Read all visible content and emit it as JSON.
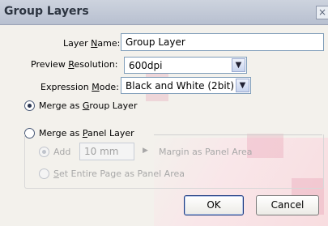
{
  "window": {
    "title": "Group Layers",
    "close_glyph": "×"
  },
  "fields": {
    "layer_name": {
      "label_before": "Layer ",
      "label_mnemonic": "N",
      "label_after": "ame:",
      "value": "Group Layer"
    },
    "preview_resolution": {
      "label_before": "Preview ",
      "label_mnemonic": "R",
      "label_after": "esolution:",
      "value": "600dpi"
    },
    "expression_mode": {
      "label_before": "Expression ",
      "label_mnemonic": "M",
      "label_after": "ode:",
      "value": "Black and White (2bit)"
    }
  },
  "merge_options": {
    "group": {
      "label_before": "Merge as ",
      "label_mnemonic": "G",
      "label_after": "roup Layer",
      "selected": true
    },
    "panel": {
      "label_before": "Merge as ",
      "label_mnemonic": "P",
      "label_after": "anel Layer",
      "selected": false
    }
  },
  "panel_options": {
    "add_label": "Add",
    "add_value": "10 mm",
    "margin_label": "Margin as Panel Area",
    "entire_page_mnemonic": "S",
    "entire_page_label_after": "et Entire Page as Panel Area"
  },
  "buttons": {
    "ok": "OK",
    "cancel": "Cancel"
  },
  "icons": {
    "dropdown": "chevron-down-icon",
    "close": "close-icon",
    "spin": "triangle-right-icon"
  }
}
